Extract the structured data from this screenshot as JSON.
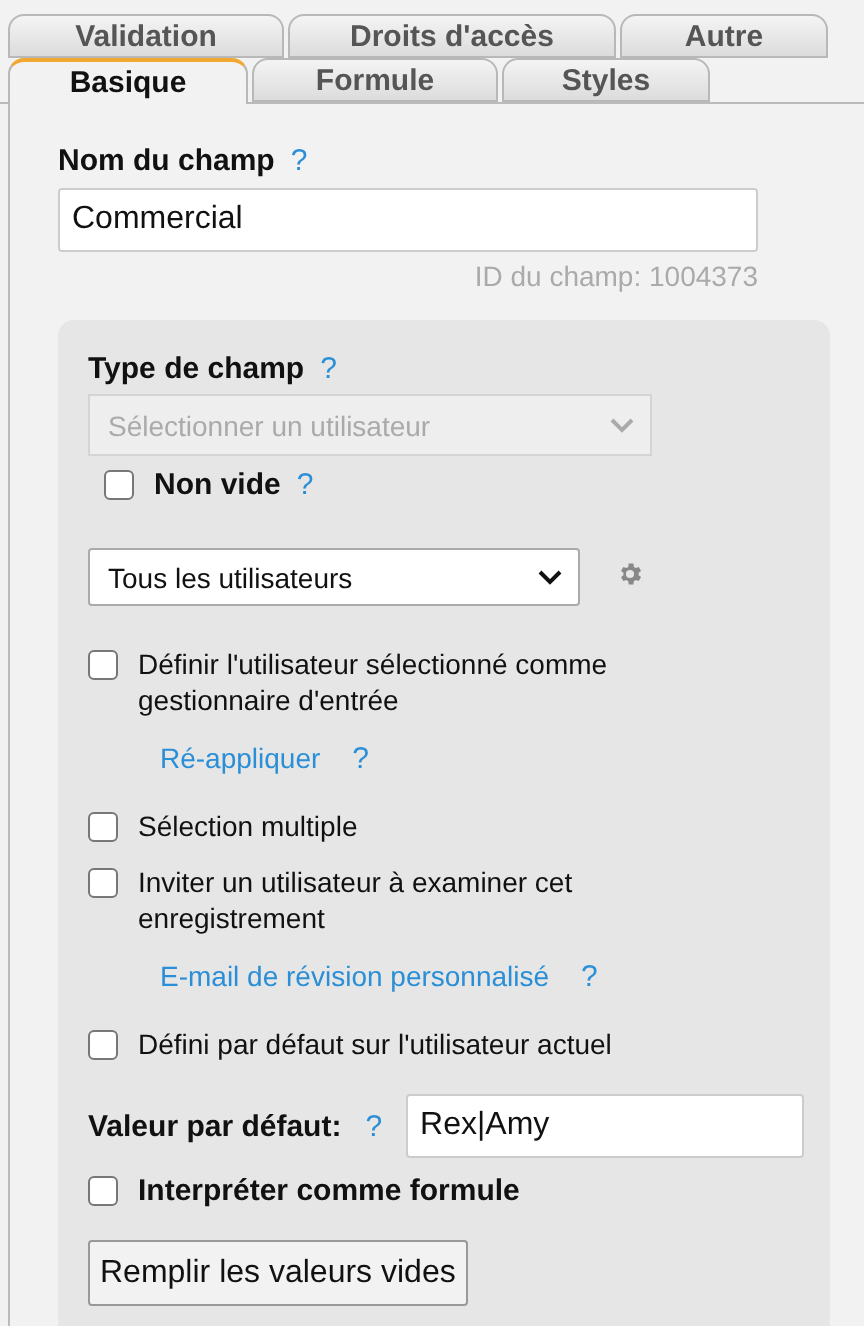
{
  "tab_rows": [
    [
      {
        "label": "Validation",
        "selected": false
      },
      {
        "label": "Droits d'accès",
        "selected": false
      },
      {
        "label": "Autre",
        "selected": false
      }
    ],
    [
      {
        "label": "Basique",
        "selected": true
      },
      {
        "label": "Formule",
        "selected": false
      },
      {
        "label": "Styles",
        "selected": false
      }
    ]
  ],
  "field_name": {
    "label": "Nom du champ",
    "help": "?",
    "value": "Commercial",
    "id_text": "ID du champ: 1004373"
  },
  "field_type": {
    "label": "Type de champ",
    "help": "?",
    "value": "Sélectionner un utilisateur",
    "disabled": true
  },
  "required": {
    "label": "Non vide",
    "help": "?",
    "checked": false
  },
  "user_filter": {
    "value": "Tous les utilisateurs"
  },
  "options": [
    {
      "kind": "checkbox",
      "label": "Définir l'utilisateur sélectionné comme gestionnaire d'entrée",
      "checked": false
    },
    {
      "kind": "link",
      "label": "Ré-appliquer",
      "help": "?"
    },
    {
      "kind": "checkbox",
      "label": "Sélection multiple",
      "checked": false
    },
    {
      "kind": "checkbox",
      "label": "Inviter un utilisateur à examiner cet enregistrement",
      "checked": false
    },
    {
      "kind": "link",
      "label": "E-mail de révision personnalisé",
      "help": "?"
    },
    {
      "kind": "checkbox",
      "label": "Défini par défaut sur l'utilisateur actuel",
      "checked": false
    }
  ],
  "default_value": {
    "label": "Valeur par défaut:",
    "help": "?",
    "value": "Rex|Amy"
  },
  "formula": {
    "label": "Interpréter comme formule",
    "checked": false
  },
  "button": "Remplir les valeurs vides"
}
